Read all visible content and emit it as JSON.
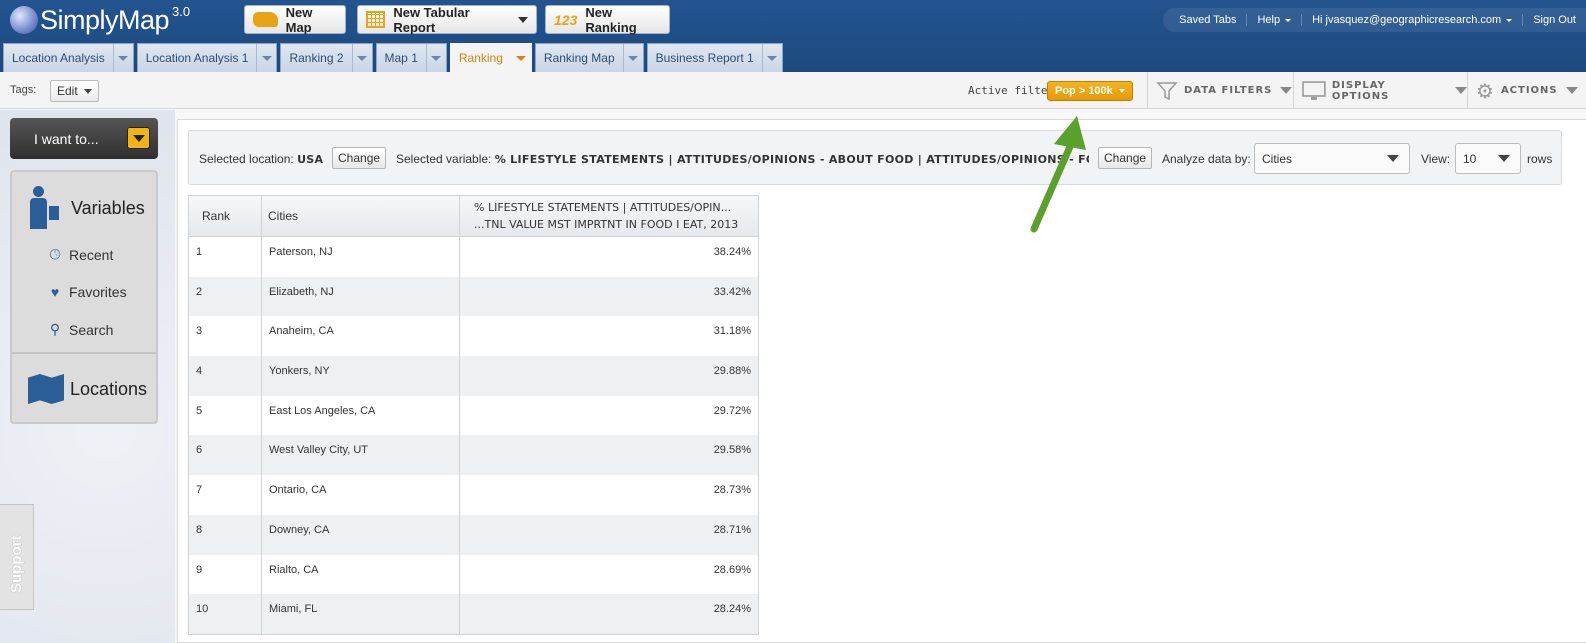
{
  "app": {
    "logo_text": "SimplyMap",
    "version": "3.0"
  },
  "toolbar_buttons": {
    "new_map": "New Map",
    "new_tabular": "New Tabular Report",
    "new_ranking_num": "123",
    "new_ranking": "New Ranking"
  },
  "userbar": {
    "saved_tabs": "Saved Tabs",
    "help": "Help",
    "user": "Hi jvasquez@geographicresearch.com",
    "sign_out": "Sign Out"
  },
  "tabs": [
    {
      "label": "Location Analysis"
    },
    {
      "label": "Location Analysis 1"
    },
    {
      "label": "Ranking 2"
    },
    {
      "label": "Map 1"
    },
    {
      "label": "Ranking"
    },
    {
      "label": "Ranking Map"
    },
    {
      "label": "Business Report 1"
    }
  ],
  "active_tab": "Ranking",
  "subtoolbar": {
    "tags_label": "Tags:",
    "edit_label": "Edit",
    "active_filter_label": "Active filter:",
    "active_filter_value": "Pop > 100k",
    "data_filters": "DATA FILTERS",
    "display_options": "DISPLAY OPTIONS",
    "actions": "ACTIONS"
  },
  "sidebar": {
    "i_want_to": "I want to...",
    "variables": "Variables",
    "recent": "Recent",
    "favorites": "Favorites",
    "search": "Search",
    "locations": "Locations",
    "support": "Support"
  },
  "selection": {
    "location_label": "Selected location:",
    "location_value": "USA",
    "change_label": "Change",
    "variable_label": "Selected variable:",
    "variable_value": "% LIFESTYLE STATEMENTS | ATTITUDES/OPINIONS - ABOUT FOOD | ATTITUDES/OPINIONS - FO...",
    "analyze_label": "Analyze data by:",
    "analyze_value": "Cities",
    "view_label": "View:",
    "view_value": "10",
    "rows_label": "rows"
  },
  "table": {
    "headers": {
      "rank": "Rank",
      "cities": "Cities",
      "value_line1": "% LIFESTYLE STATEMENTS | ATTITUDES/OPIN...",
      "value_line2": "...TNL VALUE MST IMPRTNT IN FOOD I EAT, 2013"
    },
    "rows": [
      {
        "rank": "1",
        "city": "Paterson, NJ",
        "value": "38.24%"
      },
      {
        "rank": "2",
        "city": "Elizabeth, NJ",
        "value": "33.42%"
      },
      {
        "rank": "3",
        "city": "Anaheim, CA",
        "value": "31.18%"
      },
      {
        "rank": "4",
        "city": "Yonkers, NY",
        "value": "29.88%"
      },
      {
        "rank": "5",
        "city": "East Los Angeles, CA",
        "value": "29.72%"
      },
      {
        "rank": "6",
        "city": "West Valley City, UT",
        "value": "29.58%"
      },
      {
        "rank": "7",
        "city": "Ontario, CA",
        "value": "28.73%"
      },
      {
        "rank": "8",
        "city": "Downey, CA",
        "value": "28.71%"
      },
      {
        "rank": "9",
        "city": "Rialto, CA",
        "value": "28.69%"
      },
      {
        "rank": "10",
        "city": "Miami, FL",
        "value": "28.24%"
      }
    ]
  },
  "colors": {
    "header_bg": "#1f4f88",
    "accent_orange": "#e8a317",
    "annotation_arrow": "#5aa02c"
  }
}
